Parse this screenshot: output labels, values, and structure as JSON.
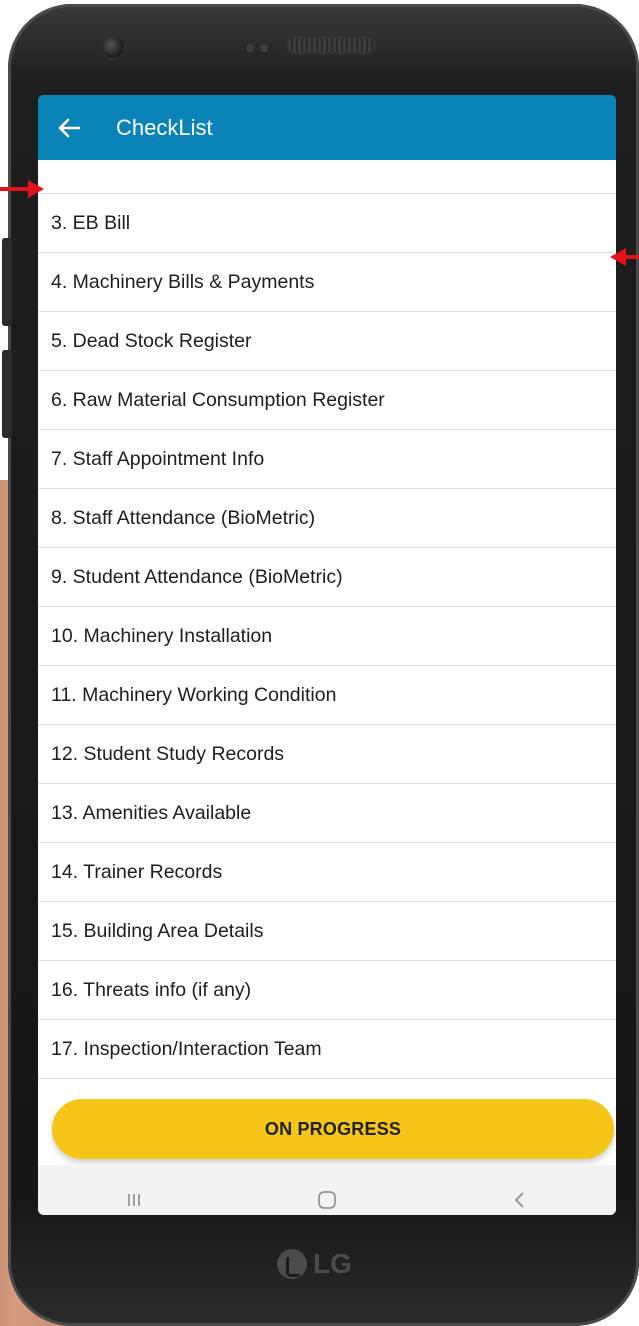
{
  "app_bar": {
    "title": "CheckList",
    "color": "#0a83b8"
  },
  "icons": {
    "back": "arrow-left-icon",
    "recents": "recents-icon",
    "home": "home-icon",
    "back_nav": "chevron-left-icon",
    "brand": "lg-logo-icon"
  },
  "checklist": {
    "items": [
      "3. EB Bill",
      "4. Machinery Bills & Payments",
      "5. Dead Stock Register",
      "6. Raw Material Consumption Register",
      "7. Staff Appointment Info",
      "8. Staff Attendance (BioMetric)",
      "9. Student Attendance (BioMetric)",
      "10. Machinery Installation",
      "11. Machinery Working Condition",
      "12. Student Study Records",
      "13. Amenities Available",
      "14. Trainer Records",
      "15. Building Area Details",
      "16. Threats info (if any)",
      "17. Inspection/Interaction Team"
    ]
  },
  "status_button": {
    "label": "ON PROGRESS",
    "color": "#f5c518"
  },
  "device": {
    "brand": "LG"
  },
  "annotations": {
    "arrow_color": "#e4121b"
  }
}
